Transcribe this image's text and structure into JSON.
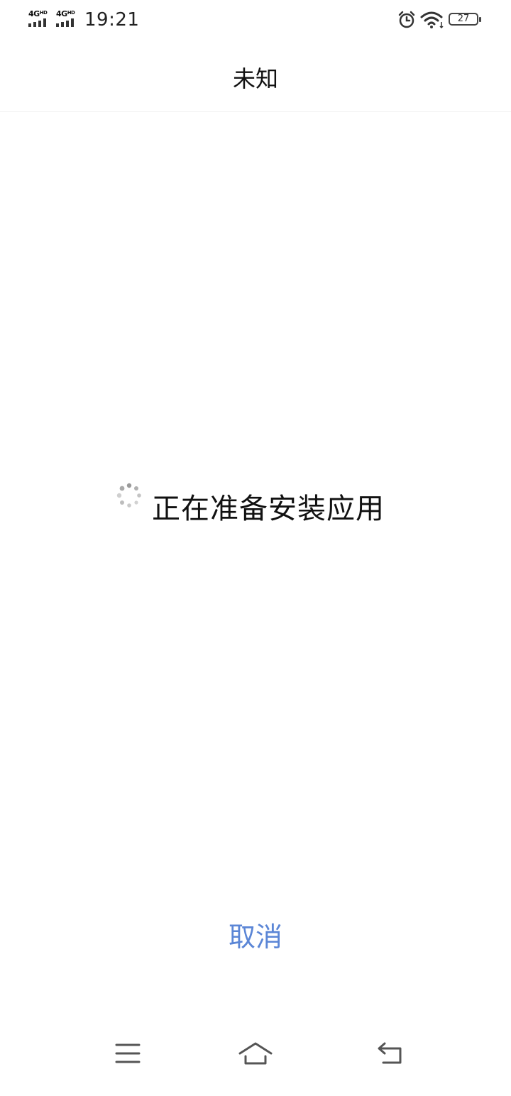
{
  "status_bar": {
    "network_1": "4G",
    "network_1_sup": "HD",
    "network_2": "4G",
    "network_2_sup": "HD",
    "time": "19:21",
    "battery_level": "27",
    "icons": [
      "signal-icon",
      "alarm-icon",
      "wifi-icon",
      "battery-icon"
    ]
  },
  "header": {
    "title": "未知"
  },
  "main": {
    "progress_text": "正在准备安装应用",
    "spinner_icon": "loading-spinner-icon"
  },
  "actions": {
    "cancel_label": "取消",
    "cancel_color": "#5b86d6"
  },
  "nav_bar": {
    "icons": [
      "menu-icon",
      "home-icon",
      "back-icon"
    ]
  }
}
